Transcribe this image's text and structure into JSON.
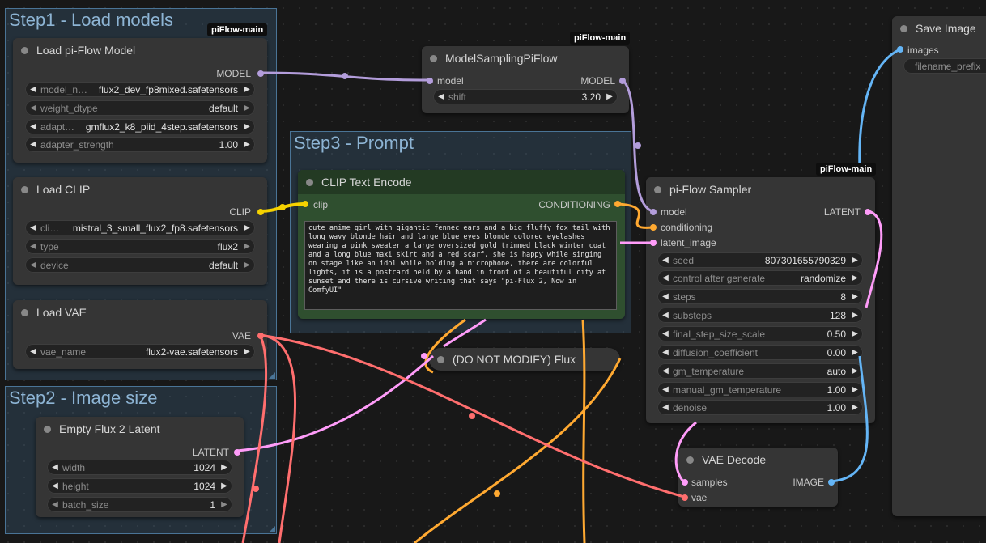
{
  "groups": {
    "step1": "Step1 - Load models",
    "step3": "Step3 - Prompt",
    "step2": "Step2 - Image size"
  },
  "badges": {
    "load_models": "piFlow-main",
    "model_sampling": "piFlow-main",
    "sampler": "piFlow-main"
  },
  "nodes": {
    "load_piflow": {
      "title": "Load pi-Flow Model",
      "output": "MODEL",
      "widgets": [
        {
          "label": "model_n…",
          "value": "flux2_dev_fp8mixed.safetensors"
        },
        {
          "label": "weight_dtype",
          "value": "default"
        },
        {
          "label": "adapt…",
          "value": "gmflux2_k8_piid_4step.safetensors"
        },
        {
          "label": "adapter_strength",
          "value": "1.00"
        }
      ]
    },
    "load_clip": {
      "title": "Load CLIP",
      "output": "CLIP",
      "widgets": [
        {
          "label": "cli…",
          "value": "mistral_3_small_flux2_fp8.safetensors"
        },
        {
          "label": "type",
          "value": "flux2"
        },
        {
          "label": "device",
          "value": "default"
        }
      ]
    },
    "load_vae": {
      "title": "Load VAE",
      "output": "VAE",
      "widgets": [
        {
          "label": "vae_name",
          "value": "flux2-vae.safetensors"
        }
      ]
    },
    "empty_latent": {
      "title": "Empty Flux 2 Latent",
      "output": "LATENT",
      "widgets": [
        {
          "label": "width",
          "value": "1024"
        },
        {
          "label": "height",
          "value": "1024"
        },
        {
          "label": "batch_size",
          "value": "1"
        }
      ]
    },
    "model_sampling": {
      "title": "ModelSamplingPiFlow",
      "input": "model",
      "output": "MODEL",
      "widgets": [
        {
          "label": "shift",
          "value": "3.20"
        }
      ]
    },
    "clip_encode": {
      "title": "CLIP Text Encode",
      "input": "clip",
      "output": "CONDITIONING",
      "text": "cute anime girl with gigantic fennec ears and a big fluffy fox tail with long wavy blonde hair and large blue eyes blonde colored eyelashes wearing a pink sweater a large oversized gold trimmed black winter coat and a long blue maxi skirt and a red scarf, she is happy while singing on stage like an idol while holding a microphone, there are colorful lights, it is a postcard held by a hand in front of a beautiful city at sunset and there is cursive writing that says \"pi-Flux 2, Now in ComfyUI\""
    },
    "flux_reroute": {
      "title": "(DO NOT MODIFY) Flux"
    },
    "sampler": {
      "title": "pi-Flow Sampler",
      "inputs": [
        "model",
        "conditioning",
        "latent_image"
      ],
      "output": "LATENT",
      "widgets": [
        {
          "label": "seed",
          "value": "807301655790329"
        },
        {
          "label": "control after generate",
          "value": "randomize"
        },
        {
          "label": "steps",
          "value": "8"
        },
        {
          "label": "substeps",
          "value": "128"
        },
        {
          "label": "final_step_size_scale",
          "value": "0.50"
        },
        {
          "label": "diffusion_coefficient",
          "value": "0.00"
        },
        {
          "label": "gm_temperature",
          "value": "auto"
        },
        {
          "label": "manual_gm_temperature",
          "value": "1.00"
        },
        {
          "label": "denoise",
          "value": "1.00"
        }
      ]
    },
    "vae_decode": {
      "title": "VAE Decode",
      "inputs": [
        "samples",
        "vae"
      ],
      "output": "IMAGE"
    },
    "save_image": {
      "title": "Save Image",
      "input": "images",
      "widget": "filename_prefix"
    }
  },
  "colors": {
    "canvas": "#181818",
    "node": "#353535",
    "group": "#3d6282",
    "prompt_node": "#2f4f2f",
    "model_wire": "#b39ddb",
    "clip_wire": "#f5d200",
    "vae_wire": "#ff6e6e",
    "latent_wire": "#ff9cf9",
    "conditioning_wire": "#ffa931",
    "image_wire": "#64b5f6"
  }
}
